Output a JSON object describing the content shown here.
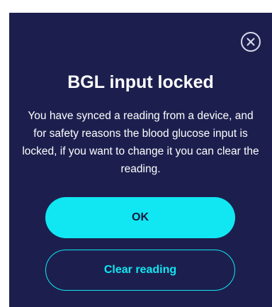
{
  "dialog": {
    "title": "BGL input locked",
    "message": "You have synced a reading from a device, and for safety reasons the blood glucose input is locked, if you want to change it you can clear the reading.",
    "close_icon": "close-circle-icon",
    "ok_label": "OK",
    "clear_label": "Clear reading"
  },
  "colors": {
    "background": "#1c1f4e",
    "accent": "#11e7f2",
    "text": "#ffffff",
    "button_text_dark": "#15173f",
    "icon": "#d7d9ec"
  }
}
